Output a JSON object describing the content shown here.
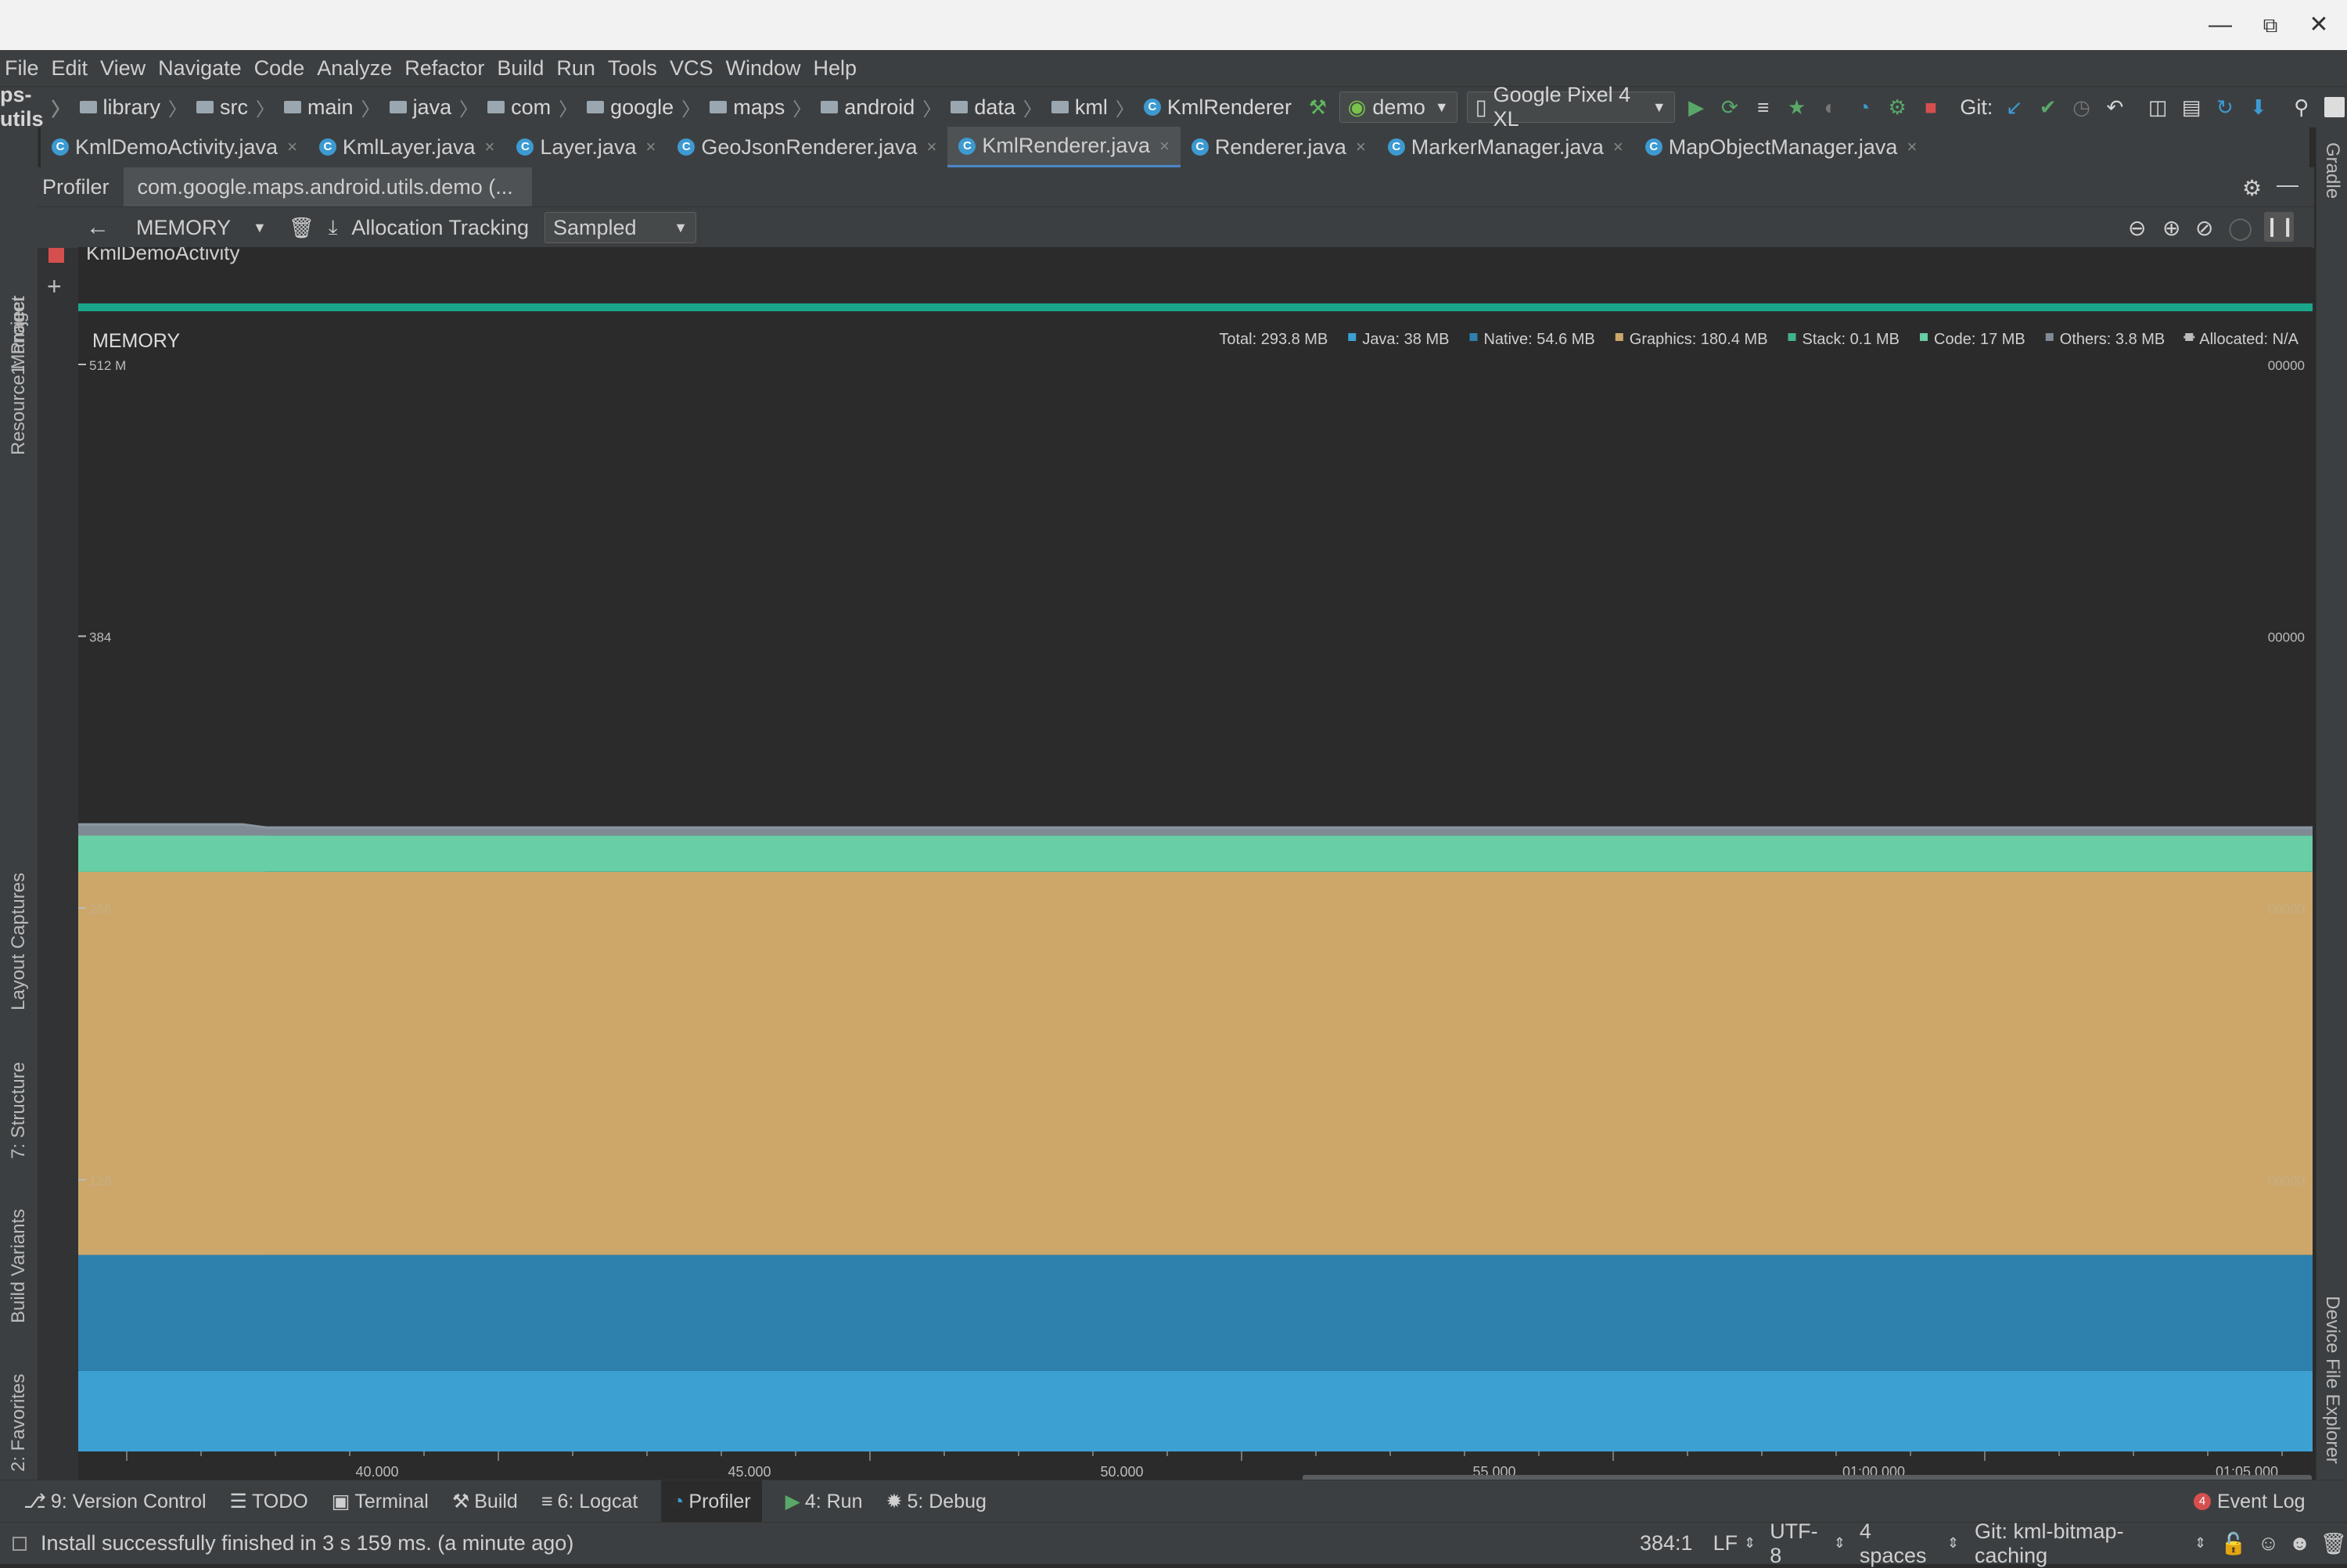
{
  "menu": [
    "File",
    "Edit",
    "View",
    "Navigate",
    "Code",
    "Analyze",
    "Refactor",
    "Build",
    "Run",
    "Tools",
    "VCS",
    "Window",
    "Help"
  ],
  "breadcrumbs": [
    {
      "label": "ps-utils",
      "icon": "none"
    },
    {
      "label": "library",
      "icon": "folder"
    },
    {
      "label": "src",
      "icon": "folder"
    },
    {
      "label": "main",
      "icon": "folder"
    },
    {
      "label": "java",
      "icon": "folder"
    },
    {
      "label": "com",
      "icon": "folder"
    },
    {
      "label": "google",
      "icon": "folder"
    },
    {
      "label": "maps",
      "icon": "folder"
    },
    {
      "label": "android",
      "icon": "folder"
    },
    {
      "label": "data",
      "icon": "folder"
    },
    {
      "label": "kml",
      "icon": "folder"
    },
    {
      "label": "KmlRenderer",
      "icon": "class"
    }
  ],
  "toolbar": {
    "run_config": "demo",
    "device": "Google Pixel 4 XL",
    "git_label": "Git:"
  },
  "tabs": [
    {
      "label": "KmlDemoActivity.java",
      "active": false
    },
    {
      "label": "KmlLayer.java",
      "active": false
    },
    {
      "label": "Layer.java",
      "active": false
    },
    {
      "label": "GeoJsonRenderer.java",
      "active": false
    },
    {
      "label": "KmlRenderer.java",
      "active": true
    },
    {
      "label": "Renderer.java",
      "active": false
    },
    {
      "label": "MarkerManager.java",
      "active": false
    },
    {
      "label": "MapObjectManager.java",
      "active": false
    }
  ],
  "left_tools": [
    "1: Project",
    "Resource Manager",
    "Layout Captures",
    "7: Structure",
    "Build Variants",
    "2: Favorites"
  ],
  "right_tools": [
    "Gradle",
    "Device File Explorer"
  ],
  "profiler": {
    "title": "Profiler",
    "session": "com.google.maps.android.utils.demo (...",
    "monitor": "MEMORY",
    "alloc_label": "Allocation Tracking",
    "alloc_mode": "Sampled",
    "activity": "KmlDemoActivity"
  },
  "chart_data": {
    "type": "area",
    "title": "MEMORY",
    "stacked": true,
    "y_ticks": [
      "512 M",
      "384",
      "256",
      "128"
    ],
    "y_right_ticks": [
      "00000",
      "00000",
      "00000",
      "00000"
    ],
    "ylim": [
      0,
      512
    ],
    "x_ticks": [
      "40.000",
      "45.000",
      "50.000",
      "55.000",
      "01:00.000",
      "01:05.000"
    ],
    "legend": [
      {
        "name": "Total: 293.8 MB",
        "color": ""
      },
      {
        "name": "Java: 38 MB",
        "color": "#3ca0d3"
      },
      {
        "name": "Native: 54.6 MB",
        "color": "#2e80ad"
      },
      {
        "name": "Graphics: 180.4 MB",
        "color": "#cda769"
      },
      {
        "name": "Stack: 0.1 MB",
        "color": "#42b28a"
      },
      {
        "name": "Code: 17 MB",
        "color": "#67cea5"
      },
      {
        "name": "Others: 3.8 MB",
        "color": "#7f8a95"
      },
      {
        "name": "Allocated: N/A",
        "color": "#bbbbbb"
      }
    ],
    "series": [
      {
        "name": "Java",
        "color": "#3ca0d3",
        "values": [
          38,
          38
        ]
      },
      {
        "name": "Native",
        "color": "#2e80ad",
        "values": [
          54.6,
          54.6
        ]
      },
      {
        "name": "Graphics",
        "color": "#cda769",
        "values": [
          180.4,
          180.4
        ]
      },
      {
        "name": "Stack",
        "color": "#42b28a",
        "values": [
          0.1,
          0.1
        ]
      },
      {
        "name": "Code",
        "color": "#67cea5",
        "values": [
          17,
          17
        ]
      },
      {
        "name": "Others",
        "color": "#7f8a95",
        "values": [
          3.8,
          3.8
        ]
      }
    ]
  },
  "bottom_tools": [
    {
      "label": "9: Version Control",
      "icon": "branch-icon",
      "active": false
    },
    {
      "label": "TODO",
      "icon": "list-icon",
      "active": false
    },
    {
      "label": "Terminal",
      "icon": "terminal-icon",
      "active": false
    },
    {
      "label": "Build",
      "icon": "hammer-icon",
      "active": false
    },
    {
      "label": "6: Logcat",
      "icon": "logcat-icon",
      "active": false
    },
    {
      "label": "Profiler",
      "icon": "gauge-icon",
      "active": true
    },
    {
      "label": "4: Run",
      "icon": "run-icon",
      "active": false
    },
    {
      "label": "5: Debug",
      "icon": "bug-icon",
      "active": false
    }
  ],
  "event_log": "Event Log",
  "status": {
    "message": "Install successfully finished in 3 s 159 ms. (a minute ago)",
    "position": "384:1",
    "line_sep": "LF",
    "encoding": "UTF-8",
    "indent": "4 spaces",
    "git": "Git: kml-bitmap-caching"
  }
}
